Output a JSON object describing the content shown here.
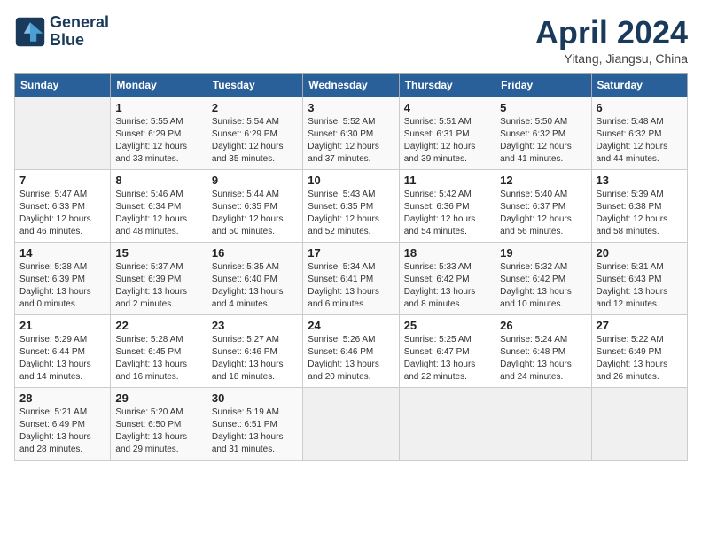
{
  "header": {
    "logo_line1": "General",
    "logo_line2": "Blue",
    "title": "April 2024",
    "location": "Yitang, Jiangsu, China"
  },
  "weekdays": [
    "Sunday",
    "Monday",
    "Tuesday",
    "Wednesday",
    "Thursday",
    "Friday",
    "Saturday"
  ],
  "weeks": [
    [
      {
        "day": "",
        "info": ""
      },
      {
        "day": "1",
        "info": "Sunrise: 5:55 AM\nSunset: 6:29 PM\nDaylight: 12 hours\nand 33 minutes."
      },
      {
        "day": "2",
        "info": "Sunrise: 5:54 AM\nSunset: 6:29 PM\nDaylight: 12 hours\nand 35 minutes."
      },
      {
        "day": "3",
        "info": "Sunrise: 5:52 AM\nSunset: 6:30 PM\nDaylight: 12 hours\nand 37 minutes."
      },
      {
        "day": "4",
        "info": "Sunrise: 5:51 AM\nSunset: 6:31 PM\nDaylight: 12 hours\nand 39 minutes."
      },
      {
        "day": "5",
        "info": "Sunrise: 5:50 AM\nSunset: 6:32 PM\nDaylight: 12 hours\nand 41 minutes."
      },
      {
        "day": "6",
        "info": "Sunrise: 5:48 AM\nSunset: 6:32 PM\nDaylight: 12 hours\nand 44 minutes."
      }
    ],
    [
      {
        "day": "7",
        "info": "Sunrise: 5:47 AM\nSunset: 6:33 PM\nDaylight: 12 hours\nand 46 minutes."
      },
      {
        "day": "8",
        "info": "Sunrise: 5:46 AM\nSunset: 6:34 PM\nDaylight: 12 hours\nand 48 minutes."
      },
      {
        "day": "9",
        "info": "Sunrise: 5:44 AM\nSunset: 6:35 PM\nDaylight: 12 hours\nand 50 minutes."
      },
      {
        "day": "10",
        "info": "Sunrise: 5:43 AM\nSunset: 6:35 PM\nDaylight: 12 hours\nand 52 minutes."
      },
      {
        "day": "11",
        "info": "Sunrise: 5:42 AM\nSunset: 6:36 PM\nDaylight: 12 hours\nand 54 minutes."
      },
      {
        "day": "12",
        "info": "Sunrise: 5:40 AM\nSunset: 6:37 PM\nDaylight: 12 hours\nand 56 minutes."
      },
      {
        "day": "13",
        "info": "Sunrise: 5:39 AM\nSunset: 6:38 PM\nDaylight: 12 hours\nand 58 minutes."
      }
    ],
    [
      {
        "day": "14",
        "info": "Sunrise: 5:38 AM\nSunset: 6:39 PM\nDaylight: 13 hours\nand 0 minutes."
      },
      {
        "day": "15",
        "info": "Sunrise: 5:37 AM\nSunset: 6:39 PM\nDaylight: 13 hours\nand 2 minutes."
      },
      {
        "day": "16",
        "info": "Sunrise: 5:35 AM\nSunset: 6:40 PM\nDaylight: 13 hours\nand 4 minutes."
      },
      {
        "day": "17",
        "info": "Sunrise: 5:34 AM\nSunset: 6:41 PM\nDaylight: 13 hours\nand 6 minutes."
      },
      {
        "day": "18",
        "info": "Sunrise: 5:33 AM\nSunset: 6:42 PM\nDaylight: 13 hours\nand 8 minutes."
      },
      {
        "day": "19",
        "info": "Sunrise: 5:32 AM\nSunset: 6:42 PM\nDaylight: 13 hours\nand 10 minutes."
      },
      {
        "day": "20",
        "info": "Sunrise: 5:31 AM\nSunset: 6:43 PM\nDaylight: 13 hours\nand 12 minutes."
      }
    ],
    [
      {
        "day": "21",
        "info": "Sunrise: 5:29 AM\nSunset: 6:44 PM\nDaylight: 13 hours\nand 14 minutes."
      },
      {
        "day": "22",
        "info": "Sunrise: 5:28 AM\nSunset: 6:45 PM\nDaylight: 13 hours\nand 16 minutes."
      },
      {
        "day": "23",
        "info": "Sunrise: 5:27 AM\nSunset: 6:46 PM\nDaylight: 13 hours\nand 18 minutes."
      },
      {
        "day": "24",
        "info": "Sunrise: 5:26 AM\nSunset: 6:46 PM\nDaylight: 13 hours\nand 20 minutes."
      },
      {
        "day": "25",
        "info": "Sunrise: 5:25 AM\nSunset: 6:47 PM\nDaylight: 13 hours\nand 22 minutes."
      },
      {
        "day": "26",
        "info": "Sunrise: 5:24 AM\nSunset: 6:48 PM\nDaylight: 13 hours\nand 24 minutes."
      },
      {
        "day": "27",
        "info": "Sunrise: 5:22 AM\nSunset: 6:49 PM\nDaylight: 13 hours\nand 26 minutes."
      }
    ],
    [
      {
        "day": "28",
        "info": "Sunrise: 5:21 AM\nSunset: 6:49 PM\nDaylight: 13 hours\nand 28 minutes."
      },
      {
        "day": "29",
        "info": "Sunrise: 5:20 AM\nSunset: 6:50 PM\nDaylight: 13 hours\nand 29 minutes."
      },
      {
        "day": "30",
        "info": "Sunrise: 5:19 AM\nSunset: 6:51 PM\nDaylight: 13 hours\nand 31 minutes."
      },
      {
        "day": "",
        "info": ""
      },
      {
        "day": "",
        "info": ""
      },
      {
        "day": "",
        "info": ""
      },
      {
        "day": "",
        "info": ""
      }
    ]
  ]
}
